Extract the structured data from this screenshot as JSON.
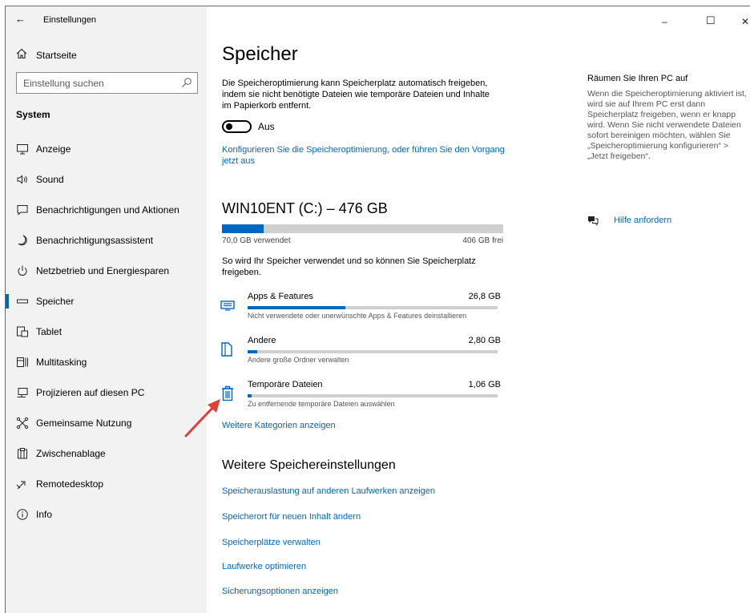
{
  "window": {
    "title": "Einstellungen",
    "back_glyph": "←",
    "minimize_glyph": "–",
    "maximize_glyph": "☐",
    "close_glyph": "✕"
  },
  "sidebar": {
    "home_label": "Startseite",
    "search_placeholder": "Einstellung suchen",
    "section_label": "System",
    "items": [
      {
        "label": "Anzeige",
        "icon": "monitor-icon"
      },
      {
        "label": "Sound",
        "icon": "speaker-icon"
      },
      {
        "label": "Benachrichtigungen und Aktionen",
        "icon": "notification-icon"
      },
      {
        "label": "Benachrichtigungsassistent",
        "icon": "moon-icon"
      },
      {
        "label": "Netzbetrieb und Energiesparen",
        "icon": "power-icon"
      },
      {
        "label": "Speicher",
        "icon": "storage-icon",
        "active": true
      },
      {
        "label": "Tablet",
        "icon": "tablet-icon"
      },
      {
        "label": "Multitasking",
        "icon": "multitasking-icon"
      },
      {
        "label": "Projizieren auf diesen PC",
        "icon": "projection-icon"
      },
      {
        "label": "Gemeinsame Nutzung",
        "icon": "share-icon"
      },
      {
        "label": "Zwischenablage",
        "icon": "clipboard-icon"
      },
      {
        "label": "Remotedesktop",
        "icon": "remote-desktop-icon"
      },
      {
        "label": "Info",
        "icon": "info-icon"
      }
    ]
  },
  "main": {
    "title": "Speicher",
    "description": "Die Speicheroptimierung kann Speicherplatz automatisch freigeben, indem sie nicht benötigte Dateien wie temporäre Dateien und Inhalte im Papierkorb entfernt.",
    "toggle_label": "Aus",
    "toggle_state": "off",
    "configure_link": "Konfigurieren Sie die Speicheroptimierung, oder führen Sie den Vorgang jetzt aus",
    "drive": {
      "title": "WIN10ENT (C:) – 476 GB",
      "used_label": "70,0 GB verwendet",
      "free_label": "406 GB frei",
      "used_fraction": 0.147
    },
    "usage_intro": "So wird Ihr Speicher verwendet und so können Sie Speicherplatz freigeben.",
    "categories": [
      {
        "name": "Apps & Features",
        "size": "26,8 GB",
        "description": "Nicht verwendete oder unerwünschte Apps & Features deinstallieren",
        "fill_fraction": 0.39,
        "icon": "apps-features-icon"
      },
      {
        "name": "Andere",
        "size": "2,80 GB",
        "description": "Andere große Ordner verwalten",
        "fill_fraction": 0.04,
        "icon": "folder-icon"
      },
      {
        "name": "Temporäre Dateien",
        "size": "1,06 GB",
        "description": "Zu entfernende temporäre Dateien auswählen",
        "fill_fraction": 0.015,
        "icon": "trash-icon"
      }
    ],
    "more_categories_link": "Weitere Kategorien anzeigen",
    "more_settings_title": "Weitere Speichereinstellungen",
    "more_settings_links": [
      "Speicherauslastung auf anderen Laufwerken anzeigen",
      "Speicherort für neuen Inhalt ändern",
      "Speicherplätze verwalten",
      "Laufwerke optimieren",
      "Sicherungsoptionen anzeigen"
    ]
  },
  "right_panel": {
    "title": "Räumen Sie Ihren PC auf",
    "text": "Wenn die Speicheroptimierung aktiviert ist, wird sie auf Ihrem PC erst dann Speicherplatz freigeben, wenn er knapp wird. Wenn Sie nicht verwendete Dateien sofort bereinigen möchten, wählen Sie „Speicheroptimierung konfigurieren“ > „Jetzt freigeben“.",
    "help_label": "Hilfe anfordern"
  },
  "colors": {
    "accent": "#0067c0",
    "sidebar_bg": "#f2f2f2",
    "bar_track": "#cfcfcf",
    "annotation_arrow": "#e0403a"
  }
}
